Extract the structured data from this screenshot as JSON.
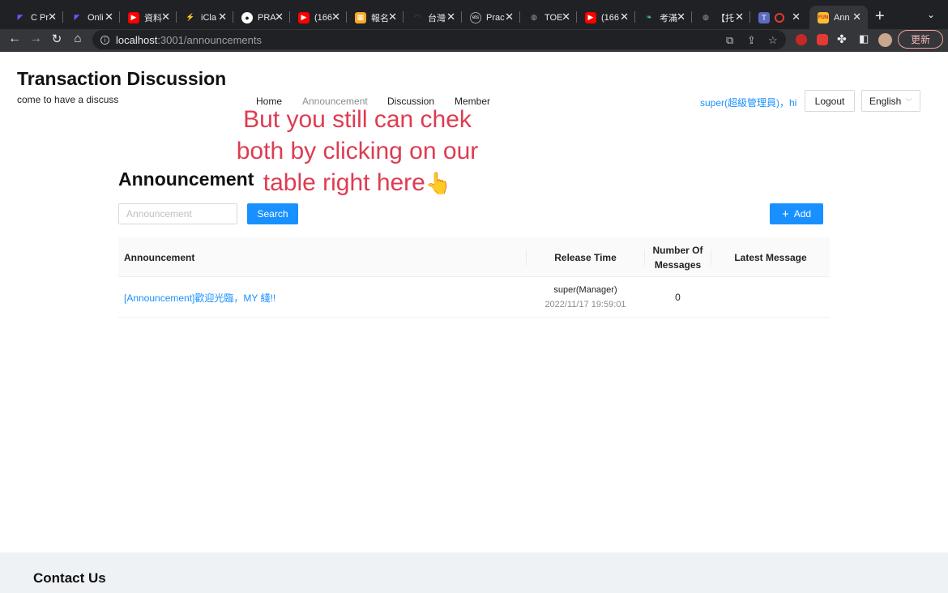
{
  "browser": {
    "tabs": [
      {
        "label": "C Pr",
        "icon": "p-logo-icon",
        "color": "#7c4dff"
      },
      {
        "label": "Onli",
        "icon": "p-logo-icon",
        "color": "#7c4dff"
      },
      {
        "label": "資料",
        "icon": "youtube-icon",
        "color": "#ff0000"
      },
      {
        "label": "iCla",
        "icon": "iclass-icon",
        "color": "#26a69a"
      },
      {
        "label": "PRA",
        "icon": "github-icon",
        "color": "#ffffff"
      },
      {
        "label": "(166",
        "icon": "youtube-icon",
        "color": "#ff0000"
      },
      {
        "label": "報名",
        "icon": "image-icon",
        "color": "#f9a825"
      },
      {
        "label": "台灣",
        "icon": "edge-icon",
        "color": "#1565c0"
      },
      {
        "label": "Prac",
        "icon": "ets-icon",
        "color": "#9e9e9e"
      },
      {
        "label": "TOE",
        "icon": "globe-icon",
        "color": "#9aa0a6"
      },
      {
        "label": "(166",
        "icon": "youtube-icon",
        "color": "#ff0000"
      },
      {
        "label": "考滿",
        "icon": "leaf-icon",
        "color": "#4db6ac"
      },
      {
        "label": "【托",
        "icon": "globe-icon",
        "color": "#9aa0a6"
      },
      {
        "label": "",
        "icon": "teams-icon",
        "color": "#5c6bc0"
      },
      {
        "label": "Ann",
        "icon": "fun-icon",
        "color": "#fbc02d"
      }
    ],
    "url_host": "localhost",
    "url_path": ":3001/announcements",
    "update_label": "更新"
  },
  "site": {
    "title": "Transaction Discussion",
    "subtitle": "come to have a discuss"
  },
  "nav": {
    "home": "Home",
    "announcement": "Announcement",
    "discussion": "Discussion",
    "member": "Member"
  },
  "user": {
    "greeting": "super(超級管理員)，hi",
    "logout": "Logout",
    "language": "English"
  },
  "overlay": {
    "line1": "But you still can chek",
    "line2": "both by clicking on our",
    "line3": "table right here",
    "emoji": "👆",
    "color": "#de3c52"
  },
  "announcements": {
    "title": "Announcement",
    "search_placeholder": "Announcement",
    "search_button": "Search",
    "add_button": "Add",
    "columns": {
      "announcement": "Announcement",
      "release_time": "Release Time",
      "messages_line1": "Number Of",
      "messages_line2": "Messages",
      "latest": "Latest Message"
    },
    "rows": [
      {
        "title": "[Announcement]歡迎光臨，MY 綫!!",
        "author": "super(Manager)",
        "time": "2022/11/17 19:59:01",
        "messages": "0",
        "latest": ""
      }
    ]
  },
  "footer": {
    "title": "Contact Us"
  },
  "colors": {
    "primary": "#1890ff",
    "chrome_dark": "#202124",
    "footer_bg": "#eff2f5"
  }
}
